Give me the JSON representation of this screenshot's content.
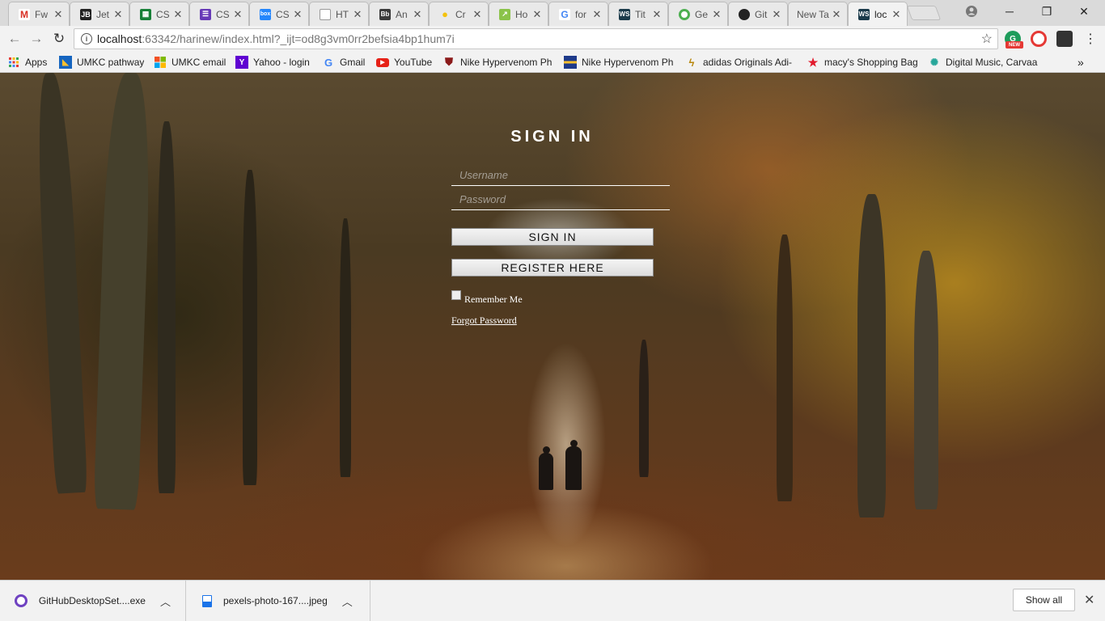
{
  "tabs": [
    {
      "title": "Fw",
      "favicon": "gmail-icon",
      "color": "#d93025"
    },
    {
      "title": "Jet",
      "favicon": "jetbrains-icon",
      "color": "#222222"
    },
    {
      "title": "CS",
      "favicon": "sheets-icon",
      "color": "#188038"
    },
    {
      "title": "CS",
      "favicon": "forms-icon",
      "color": "#673ab7"
    },
    {
      "title": "CS",
      "favicon": "box-icon",
      "color": "#2486fc"
    },
    {
      "title": "HT",
      "favicon": "page-icon",
      "color": "#9e9e9e"
    },
    {
      "title": "An",
      "favicon": "blackboard-icon",
      "color": "#3b3b3b"
    },
    {
      "title": "Cr",
      "favicon": "bulb-icon",
      "color": "#f4c20d"
    },
    {
      "title": "Ho",
      "favicon": "chart-icon",
      "color": "#8bc34a"
    },
    {
      "title": "for",
      "favicon": "google-icon",
      "color": "#4285f4"
    },
    {
      "title": "Tit",
      "favicon": "webstorm-icon",
      "color": "#1a3a4a"
    },
    {
      "title": "Ge",
      "favicon": "chrome-icon",
      "color": "#4caf50"
    },
    {
      "title": "Git",
      "favicon": "github-icon",
      "color": "#222222"
    },
    {
      "title": "New Ta",
      "favicon": "none",
      "color": ""
    },
    {
      "title": "loc",
      "favicon": "webstorm-icon",
      "color": "#1a3a4a",
      "active": true
    }
  ],
  "address": {
    "host": "localhost",
    "rest": ":63342/harinew/index.html?_ijt=od8g3vm0rr2befsia4bp1hum7i"
  },
  "bookmarks": [
    {
      "label": "Apps",
      "icon": "apps-grid-icon"
    },
    {
      "label": "UMKC pathway",
      "icon": "umkc-icon"
    },
    {
      "label": "UMKC email",
      "icon": "windows-icon"
    },
    {
      "label": "Yahoo - login",
      "icon": "yahoo-icon"
    },
    {
      "label": "Gmail",
      "icon": "google-icon"
    },
    {
      "label": "YouTube",
      "icon": "youtube-icon"
    },
    {
      "label": "Nike Hypervenom Ph",
      "icon": "shield-icon"
    },
    {
      "label": "Nike Hypervenom Ph",
      "icon": "shoe-box-icon"
    },
    {
      "label": "adidas Originals Adi-",
      "icon": "lightning-icon"
    },
    {
      "label": "macy's Shopping Bag",
      "icon": "star-icon"
    },
    {
      "label": "Digital Music, Carvaa",
      "icon": "music-icon"
    }
  ],
  "login": {
    "title": "SIGN IN",
    "username_placeholder": "Username",
    "password_placeholder": "Password",
    "signin_button": "SIGN IN",
    "register_button": "REGISTER HERE",
    "remember_label": "Remember Me",
    "forgot_link": "Forgot Password"
  },
  "downloads": [
    {
      "name": "GitHubDesktopSet....exe",
      "icon": "github-desktop-icon",
      "color": "#6f42c1"
    },
    {
      "name": "pexels-photo-167....jpeg",
      "icon": "image-file-icon",
      "color": "#1a73e8"
    }
  ],
  "shelf": {
    "show_all": "Show all"
  }
}
